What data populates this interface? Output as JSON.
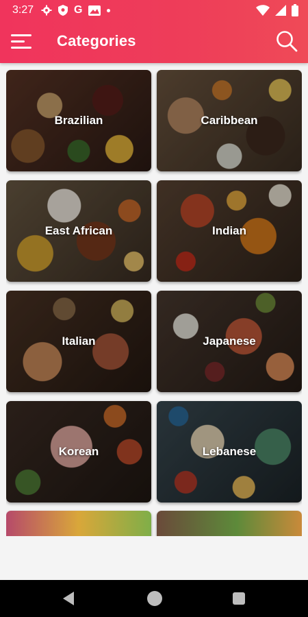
{
  "status_bar": {
    "time": "3:27",
    "icons_left": [
      "gear-icon",
      "shield-icon",
      "google-g-icon",
      "image-icon",
      "dot-icon"
    ],
    "icons_left_text": "G",
    "icons_right": [
      "wifi-icon",
      "signal-icon",
      "battery-icon"
    ]
  },
  "app_bar": {
    "title": "Categories",
    "menu_icon": "hamburger-menu-icon",
    "search_icon": "search-icon",
    "color": "#ef3a5a"
  },
  "categories": [
    {
      "label": "Brazilian"
    },
    {
      "label": "Caribbean"
    },
    {
      "label": "East African"
    },
    {
      "label": "Indian"
    },
    {
      "label": "Italian"
    },
    {
      "label": "Japanese"
    },
    {
      "label": "Korean"
    },
    {
      "label": "Lebanese"
    }
  ],
  "nav_bar": {
    "icons": [
      "back-icon",
      "home-icon",
      "recents-icon"
    ]
  }
}
